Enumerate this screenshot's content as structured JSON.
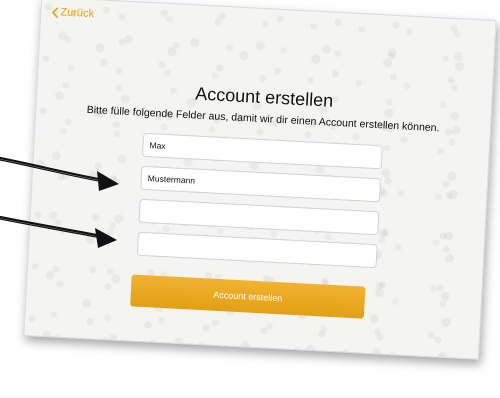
{
  "nav": {
    "back_label": "Zurück"
  },
  "main": {
    "title": "Account erstellen",
    "subtitle": "Bitte fülle folgende Felder aus, damit wir dir einen Account erstellen können."
  },
  "form": {
    "fields": [
      {
        "value": "Max",
        "placeholder": ""
      },
      {
        "value": "Mustermann",
        "placeholder": ""
      },
      {
        "value": "",
        "placeholder": ""
      },
      {
        "value": "",
        "placeholder": ""
      }
    ],
    "submit_label": "Account erstellen"
  },
  "colors": {
    "accent": "#e8a20c",
    "button": "#eaa920",
    "button_text": "#ffffff",
    "annotation_arrow": "#111111"
  }
}
